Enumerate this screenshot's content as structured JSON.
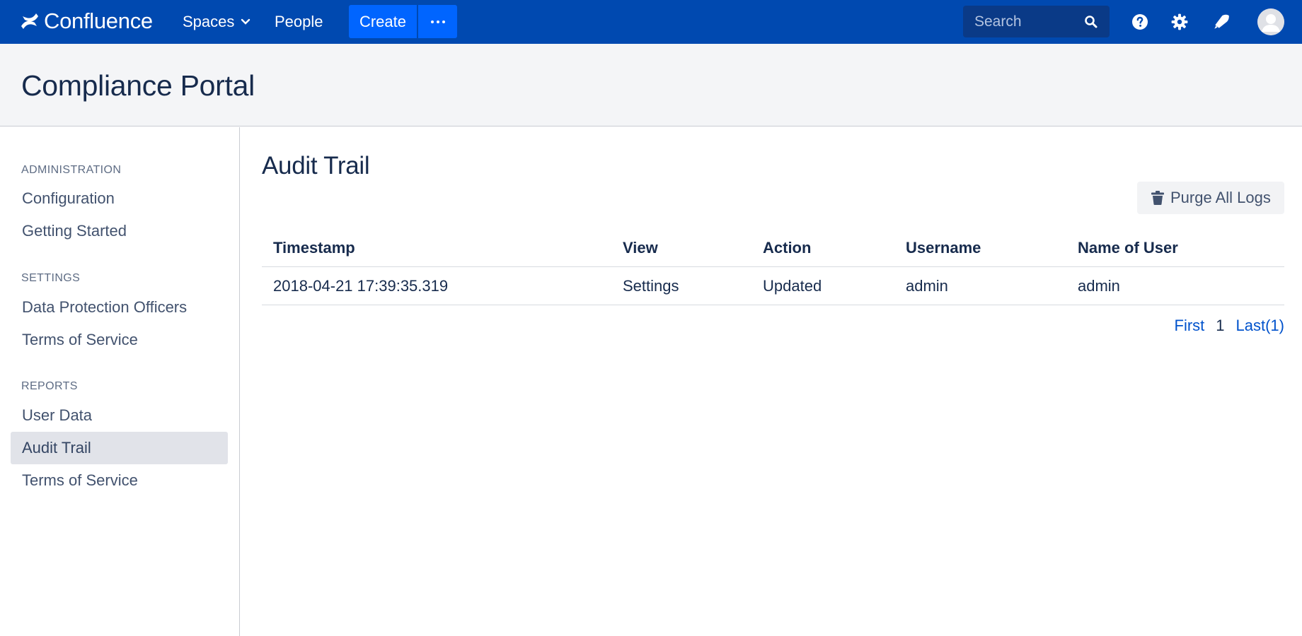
{
  "topbar": {
    "logo_text": "Confluence",
    "nav": {
      "spaces_label": "Spaces",
      "people_label": "People"
    },
    "create_label": "Create",
    "more_icon": "ellipsis-icon",
    "search": {
      "placeholder": "Search",
      "icon": "search-icon"
    },
    "icons": [
      "help-icon",
      "gear-icon",
      "notifications-icon",
      "avatar"
    ],
    "brand_color": "#0049b0",
    "create_color": "#0065ff"
  },
  "space": {
    "title": "Compliance Portal"
  },
  "sidebar": {
    "sections": [
      {
        "heading": "ADMINISTRATION",
        "items": [
          {
            "label": "Configuration",
            "active": false
          },
          {
            "label": "Getting Started",
            "active": false
          }
        ]
      },
      {
        "heading": "SETTINGS",
        "items": [
          {
            "label": "Data Protection Officers",
            "active": false
          },
          {
            "label": "Terms of Service",
            "active": false
          }
        ]
      },
      {
        "heading": "REPORTS",
        "items": [
          {
            "label": "User Data",
            "active": false
          },
          {
            "label": "Audit Trail",
            "active": true
          },
          {
            "label": "Terms of Service",
            "active": false
          }
        ]
      }
    ]
  },
  "main": {
    "title": "Audit Trail",
    "purge_button_label": "Purge All Logs",
    "table": {
      "columns": [
        "Timestamp",
        "View",
        "Action",
        "Username",
        "Name of User"
      ],
      "rows": [
        [
          "2018-04-21 17:39:35.319",
          "Settings",
          "Updated",
          "admin",
          "admin"
        ]
      ]
    },
    "pagination": {
      "first_label": "First",
      "current_page": "1",
      "last_label": "Last(1)"
    },
    "link_color": "#0052cc"
  }
}
